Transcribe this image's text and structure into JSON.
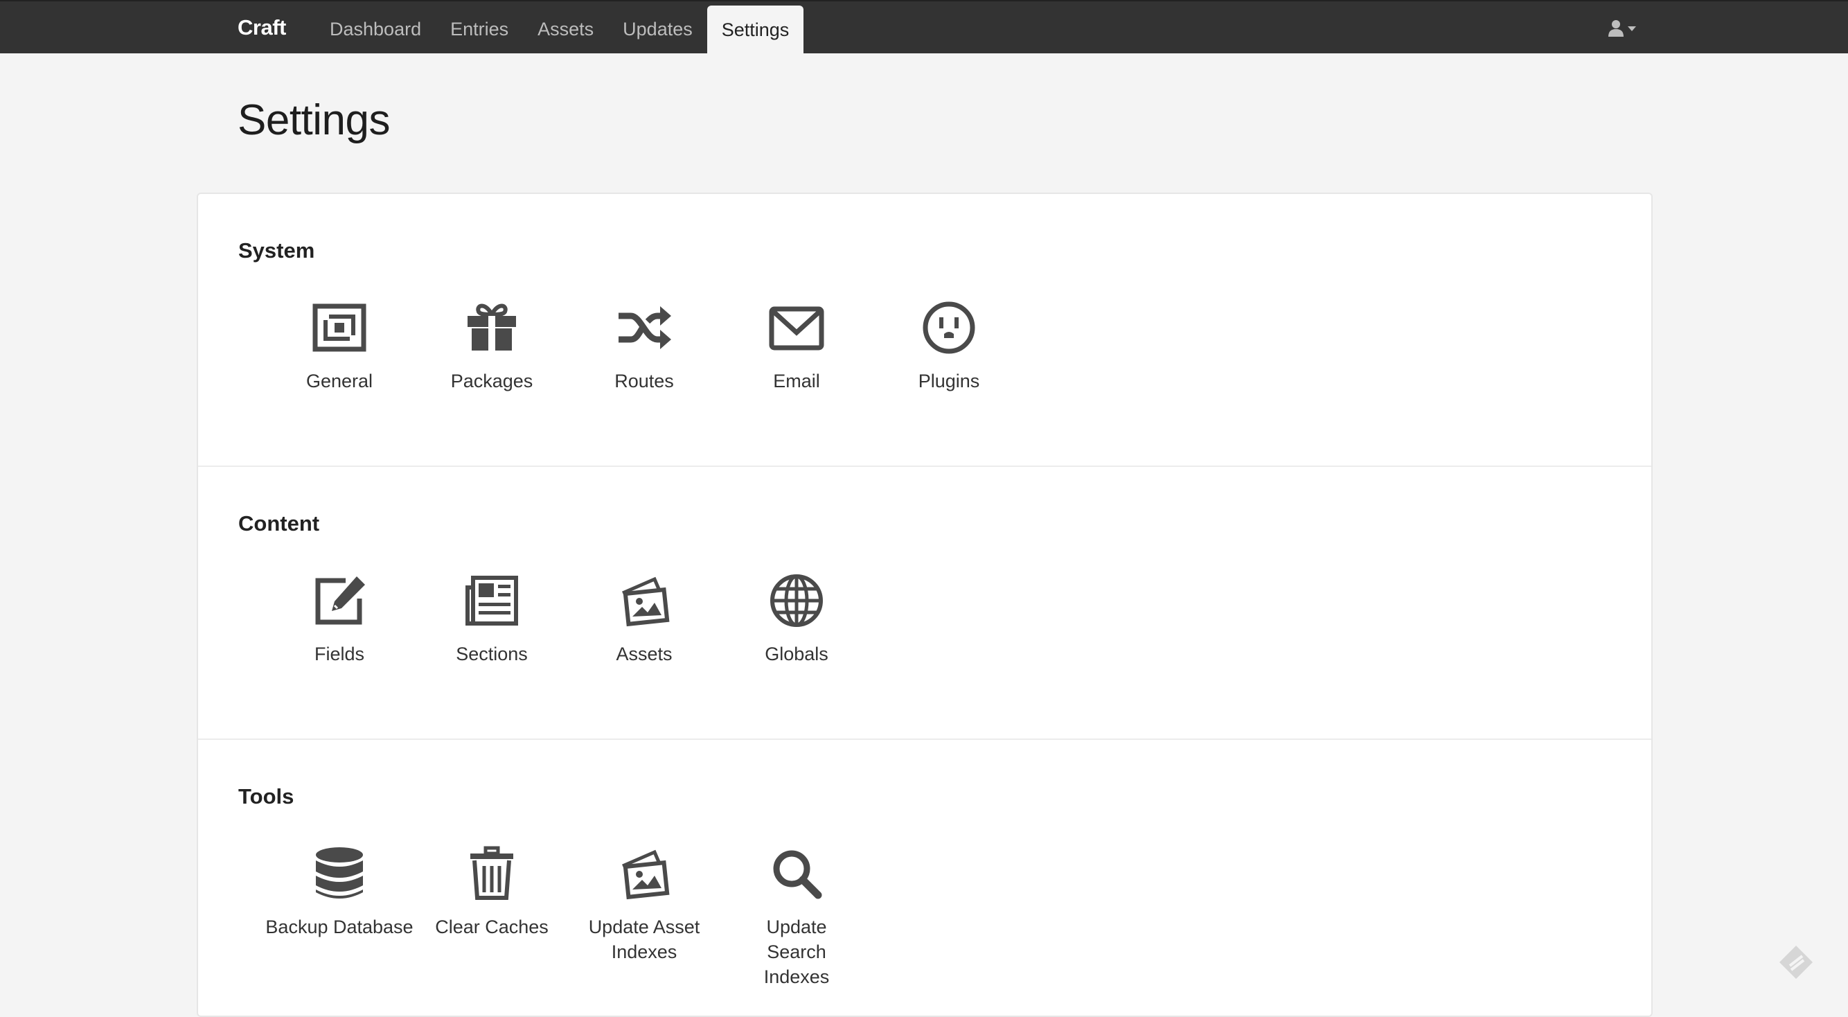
{
  "app": {
    "brand": "Craft"
  },
  "nav": {
    "items": [
      {
        "label": "Dashboard"
      },
      {
        "label": "Entries"
      },
      {
        "label": "Assets"
      },
      {
        "label": "Updates"
      },
      {
        "label": "Settings",
        "active": true
      }
    ]
  },
  "page": {
    "title": "Settings"
  },
  "sections": [
    {
      "title": "System",
      "items": [
        {
          "label": "General",
          "icon": "general-icon"
        },
        {
          "label": "Packages",
          "icon": "gift-icon"
        },
        {
          "label": "Routes",
          "icon": "shuffle-icon"
        },
        {
          "label": "Email",
          "icon": "envelope-icon"
        },
        {
          "label": "Plugins",
          "icon": "outlet-icon"
        }
      ]
    },
    {
      "title": "Content",
      "items": [
        {
          "label": "Fields",
          "icon": "edit-icon"
        },
        {
          "label": "Sections",
          "icon": "newspaper-icon"
        },
        {
          "label": "Assets",
          "icon": "photos-icon"
        },
        {
          "label": "Globals",
          "icon": "globe-icon"
        }
      ]
    },
    {
      "title": "Tools",
      "items": [
        {
          "label": "Backup Database",
          "icon": "database-icon"
        },
        {
          "label": "Clear Caches",
          "icon": "trash-icon"
        },
        {
          "label": "Update Asset Indexes",
          "icon": "photos-icon"
        },
        {
          "label": "Update Search Indexes",
          "icon": "search-icon"
        }
      ]
    }
  ],
  "colors": {
    "topbar": "#333333",
    "background": "#f4f4f4",
    "icon": "#4a4a4a"
  }
}
